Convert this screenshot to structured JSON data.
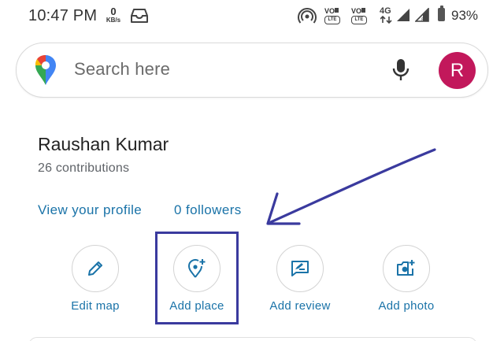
{
  "status_bar": {
    "time": "10:47 PM",
    "net_speed_value": "0",
    "net_speed_unit": "KB/s",
    "network_type": "4G",
    "volte_label": "VO",
    "lte_label": "LTE",
    "battery_percent": "93%",
    "icons": [
      "inbox-icon",
      "hotspot-icon",
      "volte-icon",
      "4g-icon",
      "signal-icon",
      "battery-icon"
    ]
  },
  "search": {
    "placeholder": "Search here",
    "avatar_initial": "R"
  },
  "profile": {
    "name": "Raushan Kumar",
    "contributions": "26 contributions",
    "view_profile_link": "View your profile",
    "followers_link": "0 followers"
  },
  "actions": [
    {
      "label": "Edit map",
      "icon": "pencil-icon"
    },
    {
      "label": "Add place",
      "icon": "add-place-pin-icon"
    },
    {
      "label": "Add review",
      "icon": "review-icon"
    },
    {
      "label": "Add photo",
      "icon": "add-photo-icon"
    }
  ],
  "colors": {
    "link_blue": "#1a73a8",
    "avatar_bg": "#c2185b",
    "annotation": "#3a3a9e"
  }
}
